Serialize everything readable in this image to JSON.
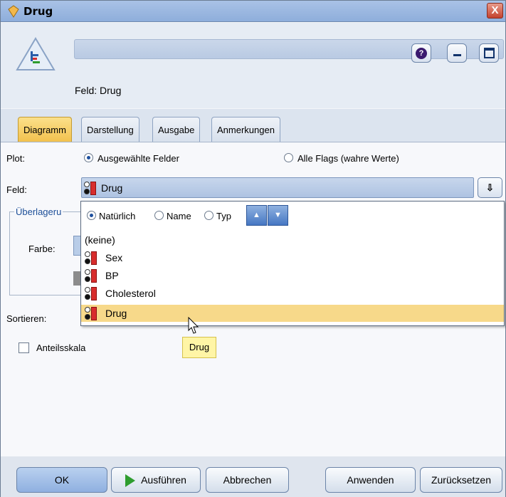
{
  "window": {
    "title": "Drug",
    "close_symbol": "X"
  },
  "header": {
    "node_label": "Feld: Drug",
    "help_symbol": "?"
  },
  "tabs": [
    "Diagramm",
    "Darstellung",
    "Ausgabe",
    "Anmerkungen"
  ],
  "plot": {
    "label": "Plot:",
    "option_selected": "Ausgewählte Felder",
    "option_other": "Alle Flags (wahre Werte)"
  },
  "field": {
    "label": "Feld:",
    "value": "Drug",
    "button_symbol": "⇩"
  },
  "overlay": {
    "group_title": "Überlageru",
    "color_label": "Farbe:"
  },
  "sort_label": "Sortieren:",
  "proportion_label": "Anteilsskala",
  "dropdown": {
    "sort_options": [
      "Natürlich",
      "Name",
      "Typ"
    ],
    "sort_selected": "Natürlich",
    "items": [
      {
        "text": "(keine)",
        "icon": false,
        "selected": false
      },
      {
        "text": "Sex",
        "icon": true,
        "selected": false
      },
      {
        "text": "BP",
        "icon": true,
        "selected": false
      },
      {
        "text": "Cholesterol",
        "icon": true,
        "selected": false
      },
      {
        "text": "Drug",
        "icon": true,
        "selected": true
      }
    ]
  },
  "tooltip": "Drug",
  "buttons": {
    "ok": "OK",
    "run": "Ausführen",
    "cancel": "Abbrechen",
    "apply": "Anwenden",
    "reset": "Zurücksetzen"
  }
}
